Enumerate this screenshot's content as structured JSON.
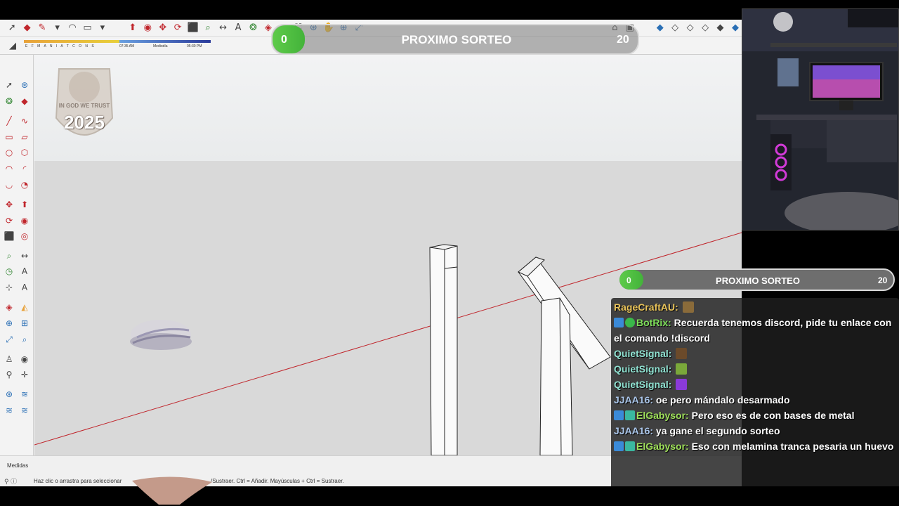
{
  "app": {
    "status_label": "Medidas",
    "status_hint": "Haz clic o arrastra para seleccionar",
    "status_hint_tail": "/Sustraer. Ctrl = Añadir. Mayúsculas + Ctrl = Sustraer.",
    "style_letters": "E F M A N I A T C O N S",
    "style_time_left": "07:35 AM",
    "style_time_mid": "Mediodía",
    "style_time_right": "05:30 PM"
  },
  "badge": {
    "line1": "IN GOD WE TRUST",
    "year": "2025"
  },
  "giveaway_top": {
    "count": "0",
    "title": "PROXIMO SORTEO",
    "goal": "20",
    "progress": 0
  },
  "giveaway_chat": {
    "count": "0",
    "title": "PROXIMO SORTEO",
    "goal": "20",
    "progress": 0
  },
  "chat": {
    "messages": [
      {
        "user": "RageCraftAU:",
        "text": "",
        "color": "#e8c35a",
        "emote": "trophy"
      },
      {
        "user": "BotRix:",
        "text": "Recuerda tenemos discord, pide tu enlace con el comando !discord",
        "color": "#7ee05a",
        "badges": [
          "mod",
          "verified"
        ]
      },
      {
        "user": "QuietSignal:",
        "text": "",
        "color": "#8fe0d0",
        "emote": "kick"
      },
      {
        "user": "QuietSignal:",
        "text": "",
        "color": "#8fe0d0",
        "emote": "lurk"
      },
      {
        "user": "QuietSignal:",
        "text": "",
        "color": "#8fe0d0",
        "emote": "purple"
      },
      {
        "user": "JJAA16:",
        "text": "oe pero mándalo desarmado",
        "color": "#a9c4e8"
      },
      {
        "user": "ElGabysor:",
        "text": "Pero eso es de con bases de metal",
        "color": "#9fe05a",
        "badges": [
          "mod",
          "sub"
        ]
      },
      {
        "user": "JJAA16:",
        "text": "ya gane el segundo sorteo",
        "color": "#a9c4e8"
      },
      {
        "user": "ElGabysor:",
        "text": "Eso con melamina tranca pesaria un huevo",
        "color": "#9fe05a",
        "badges": [
          "mod",
          "sub"
        ]
      }
    ]
  },
  "colors": {
    "green_fill": "#5ecb4a",
    "axis_red": "#c0262c",
    "sky": "#eceeef",
    "ground": "#d9d9d9"
  }
}
